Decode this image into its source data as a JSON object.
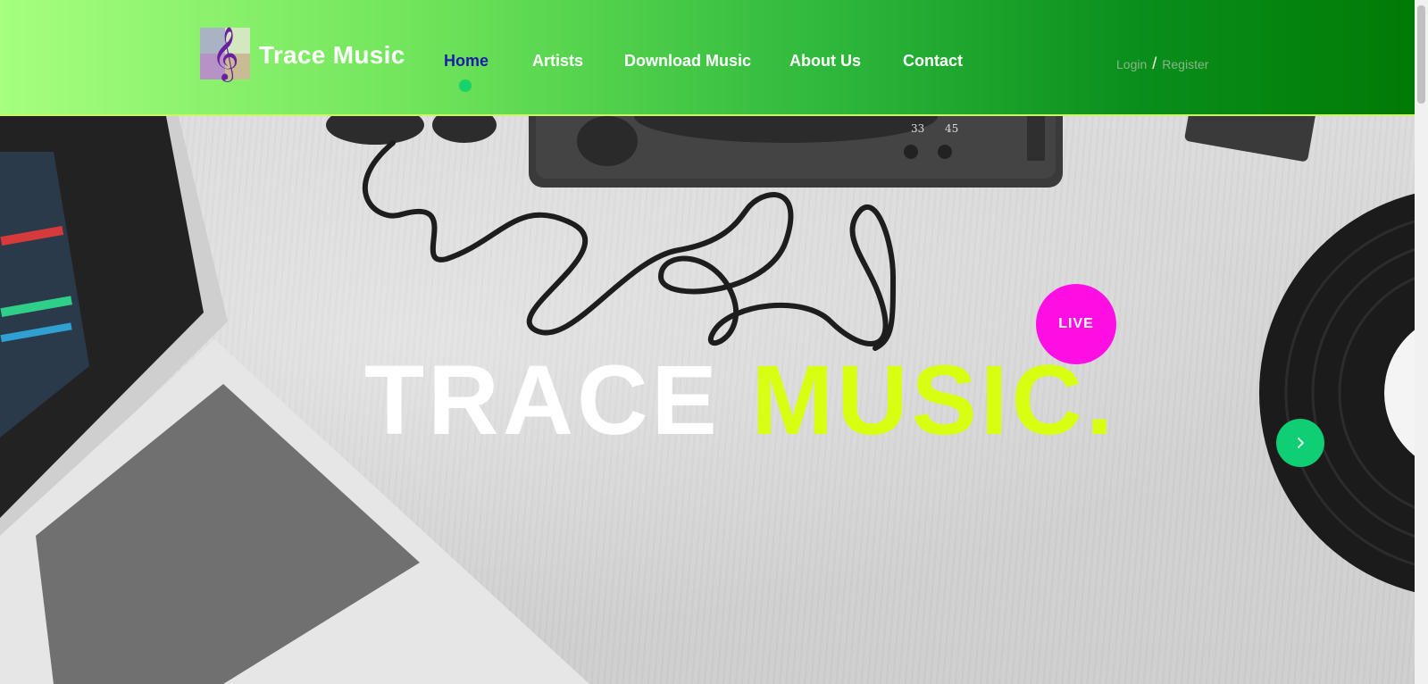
{
  "brand": {
    "name": "Trace Music",
    "logo_icon": "treble-clef-icon"
  },
  "nav": {
    "items": [
      {
        "label": "Home",
        "active": true
      },
      {
        "label": "Artists"
      },
      {
        "label": "Download Music"
      },
      {
        "label": "About Us"
      },
      {
        "label": "Contact"
      }
    ]
  },
  "auth": {
    "login": "Login",
    "separator": "/",
    "register": "Register"
  },
  "hero": {
    "title_white": "TRACE",
    "title_accent": "MUSIC.",
    "live_badge": "LIVE",
    "next_icon": "chevron-right-icon",
    "vinyl_label_33": "33",
    "vinyl_label_45": "45"
  },
  "colors": {
    "header_start": "#a6ff7e",
    "header_end": "#017a05",
    "active_nav": "#1c1ca8",
    "accent_yellow": "#d8ff12",
    "live_pink": "#ff0fe3",
    "button_green": "#0fce73"
  }
}
